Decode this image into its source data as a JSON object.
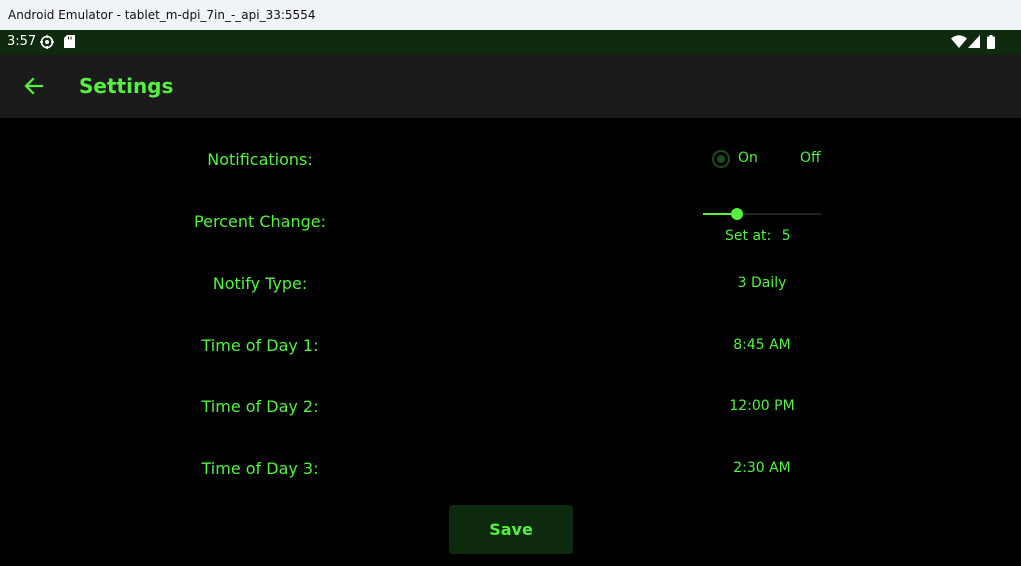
{
  "window": {
    "title": "Android Emulator - tablet_m-dpi_7in_-_api_33:5554"
  },
  "status_bar": {
    "time": "3:57"
  },
  "app_bar": {
    "title": "Settings"
  },
  "settings": {
    "notifications": {
      "label": "Notifications:",
      "on_label": "On",
      "off_label": "Off",
      "selected": "On"
    },
    "percent_change": {
      "label": "Percent Change:",
      "set_at_label": "Set at:",
      "value": "5",
      "slider_fraction": 0.29
    },
    "notify_type": {
      "label": "Notify Type:",
      "value": "3 Daily"
    },
    "time1": {
      "label": "Time of Day 1:",
      "value": "8:45 AM"
    },
    "time2": {
      "label": "Time of Day 2:",
      "value": "12:00 PM"
    },
    "time3": {
      "label": "Time of Day 3:",
      "value": "2:30 AM"
    }
  },
  "save_button": {
    "label": "Save"
  },
  "colors": {
    "accent": "#55f240",
    "background": "#000000",
    "app_bar": "#1b1b1b",
    "status_bar": "#0f2a0f",
    "button_bg": "#0e2a0e"
  }
}
